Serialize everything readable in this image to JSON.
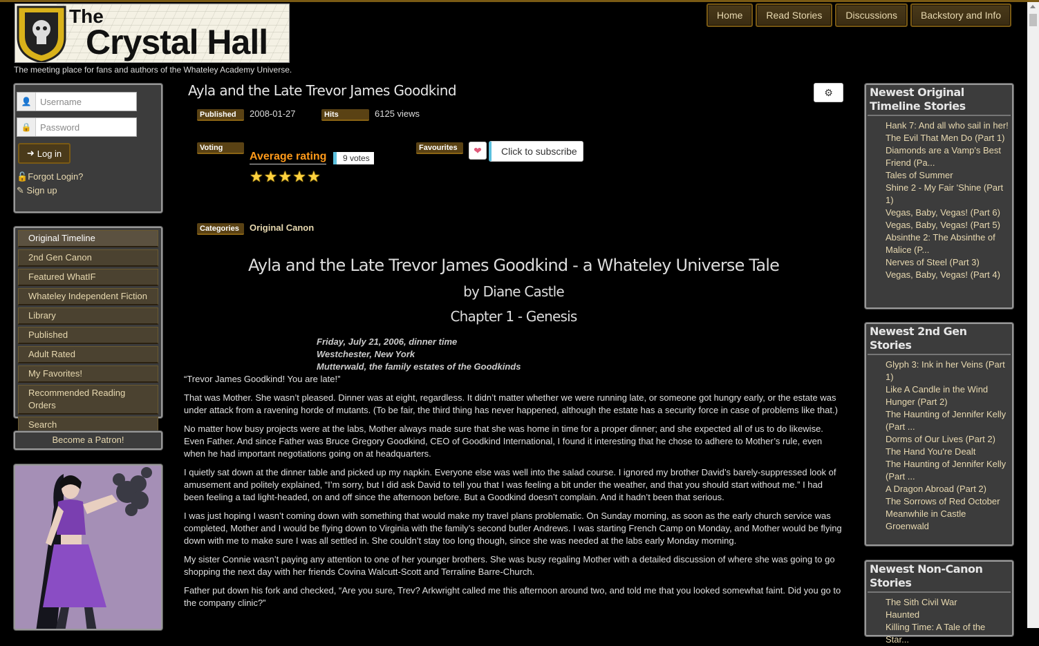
{
  "site": {
    "logo_line1": "The",
    "logo_line2": "Crystal Hall",
    "tagline": "The meeting place for fans and authors of the Whateley Academy Universe."
  },
  "topnav": [
    "Home",
    "Read Stories",
    "Discussions",
    "Backstory and Info"
  ],
  "login": {
    "username_placeholder": "Username",
    "password_placeholder": "Password",
    "login_label": "Log in",
    "forgot_label": "Forgot Login?",
    "signup_label": "Sign up"
  },
  "menu": [
    "Original Timeline",
    "2nd Gen Canon",
    "Featured WhatIF",
    "Whateley Independent Fiction",
    "Library",
    "Published",
    "Adult Rated",
    "My Favorites!",
    "Recommended Reading Orders",
    "Search"
  ],
  "patron_label": "Become a Patron!",
  "article": {
    "title": "Ayla and the Late Trevor James Goodkind",
    "published_label": "Published",
    "published_value": "2008-01-27",
    "hits_label": "Hits",
    "hits_value": "6125 views",
    "voting_label": "Voting",
    "average_rating": "Average rating",
    "votes": "9 votes",
    "rating_stars": 5,
    "favourites_label": "Favourites",
    "subscribe_label": "Click to subscribe",
    "categories_label": "Categories",
    "categories_value": "Original Canon"
  },
  "story": {
    "heading": "Ayla and the Late Trevor James Goodkind - a Whateley Universe Tale",
    "byline": "by Diane Castle",
    "chapter": "Chapter 1 - Genesis",
    "dateline": [
      "Friday, July 21, 2006, dinner time",
      "Westchester, New York",
      "Mutterwald, the family estates of the Goodkinds"
    ],
    "paragraphs": [
      "“Trevor James Goodkind!  You are late!”",
      "That was Mother.  She wasn’t pleased.  Dinner was at eight, regardless.  It didn’t matter whether we were running late, or someone got hungry early, or the estate was under attack from a ravening horde of mutants.  (To be fair, the third thing has never happened, although the estate has a security force in case of problems like that.)",
      "No matter how busy projects were at the labs, Mother always made sure that she was home in time for a proper dinner; and she expected all of us to do likewise.  Even Father.  And since Father was Bruce Gregory Goodkind, CEO of Goodkind International, I found it interesting that he chose to adhere to Mother’s rule, even when he had important negotiations going on at headquarters.",
      "I quietly sat down at the dinner table and picked up my napkin.  Everyone else was well into the salad course.  I ignored my brother David’s barely-suppressed look of amusement and politely explained, “I’m sorry, but I did ask David to tell you that I was feeling a bit under the weather, and that you should start without me.”  I had been feeling a tad light-headed, on and off since the afternoon before.  But a Goodkind doesn’t complain.  And it hadn’t been that serious.",
      "I was just hoping I wasn’t coming down with something that would make my travel plans problematic.  On Sunday morning, as soon as the early church service was completed, Mother and I would be flying down to Virginia with the family’s second butler Andrews.  I was starting French Camp on Monday, and Mother would be flying down with me to make sure I was all settled in.  She couldn’t stay too long though, since she was needed at the labs early Monday morning.",
      "My sister Connie wasn’t paying any attention to one of her younger brothers.  She was busy regaling Mother with a detailed discussion of where she was going to go shopping the next day with her friends Covina Walcutt-Scott and Terraline Barre-Church.",
      "Father put down his fork and checked, “Are you sure, Trev?  Arkwright called me this afternoon around two, and told me that you looked somewhat faint.  Did you go to the company clinic?”"
    ]
  },
  "sidebar_right": [
    {
      "title": "Newest Original Timeline Stories",
      "items": [
        "Hank 7: And all who sail in her!",
        "The Evil That Men Do (Part 1)",
        "Diamonds are a Vamp's Best Friend (Pa...",
        "Tales of Summer",
        "Shine 2 - My Fair 'Shine (Part 1)",
        "Vegas, Baby, Vegas! (Part 6)",
        "Vegas, Baby, Vegas! (Part 5)",
        "Absinthe 2: The Absinthe of Malice (P...",
        "Nerves of Steel (Part 3)",
        "Vegas, Baby, Vegas! (Part 4)"
      ]
    },
    {
      "title": "Newest 2nd Gen Stories",
      "items": [
        "Glyph 3: Ink in her Veins (Part 1)",
        "Like A Candle in the Wind Hunger (Part 2)",
        "The Haunting of Jennifer Kelly (Part ...",
        "Dorms of Our Lives (Part 2)",
        "The Hand You're Dealt",
        "The Haunting of Jennifer Kelly (Part ...",
        "A Dragon Abroad (Part 2)",
        "The Sorrows of Red October",
        "Meanwhile in Castle Groenwald"
      ]
    },
    {
      "title": "Newest Non-Canon Stories",
      "items": [
        "The Sith Civil War",
        "Haunted",
        "Killing Time: A Tale of the Star..."
      ]
    }
  ],
  "colors": {
    "accent_gold": "#7a5a14",
    "link": "#e8d9b0",
    "rating_orange": "#ff9a1a",
    "info_blue": "#5bc0de"
  }
}
